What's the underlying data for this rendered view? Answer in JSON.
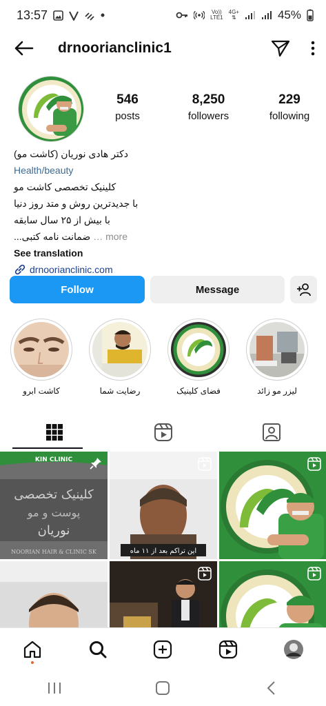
{
  "status_bar": {
    "time": "13:57",
    "net_top": "Vo))",
    "net_bottom": "LTE1",
    "net_type": "4G+",
    "battery": "45%"
  },
  "header": {
    "username": "drnoorianclinic1"
  },
  "stats": {
    "posts_count": "546",
    "posts_label": "posts",
    "followers_count": "8,250",
    "followers_label": "followers",
    "following_count": "229",
    "following_label": "following"
  },
  "bio": {
    "name": "دکتر هادی نوریان (کاشت مو)",
    "category": "Health/beauty",
    "lines": [
      "کلینیک تخصصی کاشت مو",
      "با جدیدترین روش و متد روز دنیا",
      "با بیش از ۲۵ سال سابقه",
      "ضمانت نامه کتبی..."
    ],
    "more": "more",
    "see_translation": "See translation",
    "website": "drnoorianclinic.com"
  },
  "actions": {
    "follow_label": "Follow",
    "message_label": "Message"
  },
  "highlights": [
    {
      "label": "کاشت ابرو"
    },
    {
      "label": "رضایت شما"
    },
    {
      "label": "فضای کلینیک"
    },
    {
      "label": "لیزر مو زائد"
    }
  ],
  "grid": {
    "post1_text": "کلینیک تخصصی",
    "post1_text2": "پوست و مو",
    "post1_text3": "نوریان",
    "post1_caption": "NOORIAN HAIR & CLINIC SK",
    "post1_top": "KIN CLINIC",
    "post2_caption": "این تراکم بعد از ۱۱ ماه"
  },
  "colors": {
    "follow_blue": "#1a98f4",
    "link_blue": "#1a3f8c",
    "category_blue": "#3d6b93",
    "clinic_green": "#2f8f3a"
  }
}
